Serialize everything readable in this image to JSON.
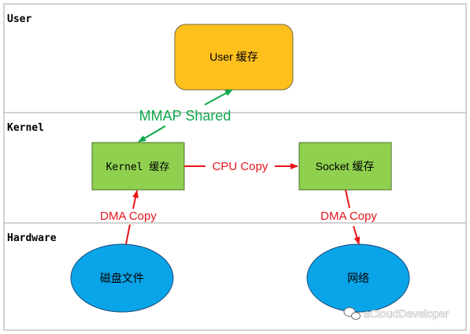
{
  "layers": {
    "user": "User",
    "kernel": "Kernel",
    "hardware": "Hardware"
  },
  "nodes": {
    "user_cache": "User 缓存",
    "kernel_cache": "Kernel 缓存",
    "socket_cache": "Socket 缓存",
    "disk_file": "磁盘文件",
    "network": "网络"
  },
  "edges": {
    "mmap": "MMAP  Shared",
    "cpu_copy": "CPU  Copy",
    "dma_left": "DMA  Copy",
    "dma_right": "DMA  Copy"
  },
  "watermark": "aCloudDeveloper",
  "colors": {
    "user_box": "#ffc01e",
    "kernel_box": "#8fd14f",
    "ellipse": "#0aa4e8",
    "red": "#e8141b",
    "green": "#0da84a",
    "divider": "#a6a6a6"
  }
}
